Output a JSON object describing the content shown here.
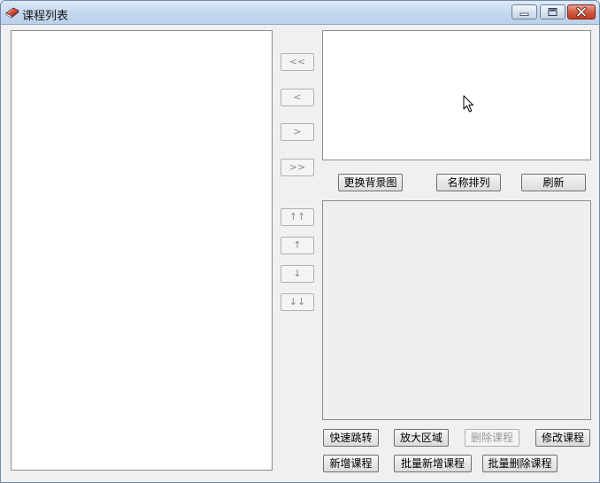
{
  "window": {
    "title": "课程列表"
  },
  "nav_buttons": {
    "first": "<<",
    "prev": "<",
    "next": ">",
    "last": ">>",
    "move_top": "↑↑",
    "move_up": "↑",
    "move_down": "↓",
    "move_bottom": "↓↓"
  },
  "toolbar": {
    "change_background": "更换背景图",
    "sort_by_name": "名称排列",
    "refresh": "刷新"
  },
  "actions": {
    "quick_jump": "快速跳转",
    "zoom_area": "放大区域",
    "delete_course": "删除课程",
    "edit_course": "修改课程",
    "add_course": "新增课程",
    "batch_add_courses": "批量新增课程",
    "batch_delete_courses": "批量删除课程"
  },
  "icons": {
    "app": "book-icon",
    "minimize": "minimize-icon",
    "maximize": "maximize-icon",
    "close": "close-icon",
    "cursor": "mouse-pointer-icon"
  },
  "colors": {
    "titlebar": "#c5d8ee",
    "close_button": "#c13c22",
    "client_background": "#f0f0f0",
    "list_background": "#ffffff",
    "detail_background": "#efefef",
    "disabled_text": "#9a9a9a"
  }
}
